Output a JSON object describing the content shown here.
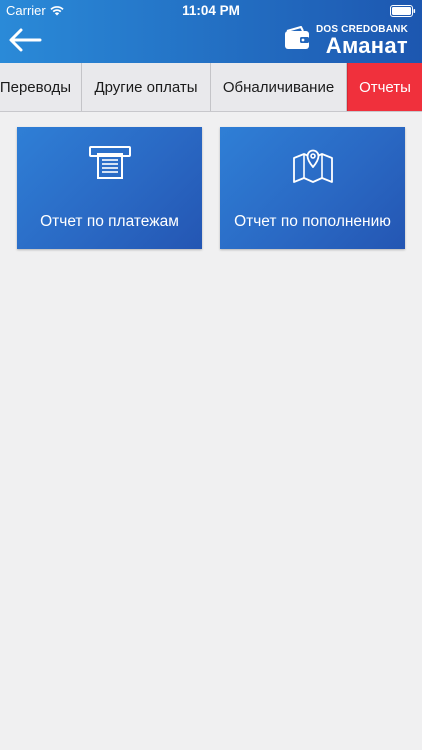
{
  "status_bar": {
    "carrier": "Carrier",
    "time": "11:04 PM",
    "wifi_icon": "wifi-icon",
    "battery_icon": "battery-icon"
  },
  "header": {
    "back_icon": "arrow-left-icon",
    "brand_sub": "DOS CREDOBANK",
    "brand_main": "Аманат",
    "brand_logo": "wallet-icon",
    "color_start": "#2a8ad8",
    "color_end": "#1d57b0"
  },
  "tabs": [
    {
      "label": "Переводы",
      "active": false
    },
    {
      "label": "Другие оплаты",
      "active": false
    },
    {
      "label": "Обналичивание",
      "active": false
    },
    {
      "label": "Отчеты",
      "active": true
    }
  ],
  "active_tab_color": "#f0303c",
  "cards": [
    {
      "label": "Отчет по платежам",
      "icon": "atm-cash-icon"
    },
    {
      "label": "Отчет по пополнению",
      "icon": "map-pin-icon"
    }
  ],
  "card_color": "#2a69c4"
}
